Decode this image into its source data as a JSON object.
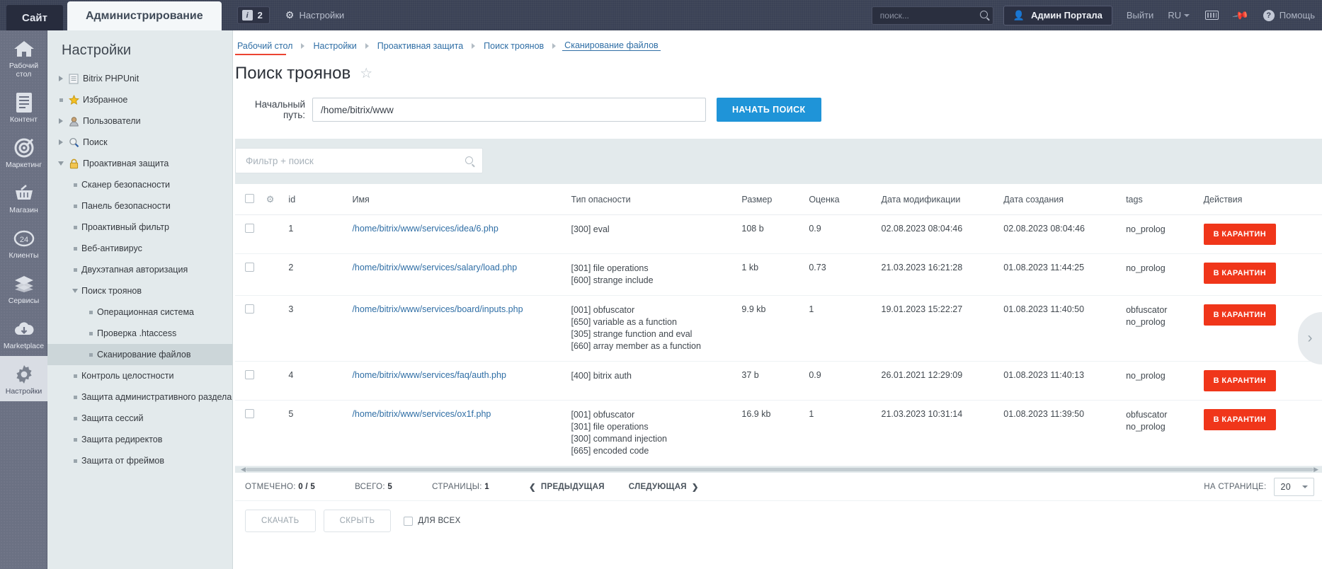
{
  "topbar": {
    "tab_site": "Сайт",
    "tab_admin": "Администрирование",
    "notifications_count": "2",
    "settings_label": "Настройки",
    "search_placeholder": "поиск...",
    "search_value": "",
    "user": "Админ Портала",
    "logout": "Выйти",
    "language": "RU",
    "help": "Помощь"
  },
  "rail": [
    {
      "label": "Рабочий стол",
      "icon": "home-icon"
    },
    {
      "label": "Контент",
      "icon": "document-icon"
    },
    {
      "label": "Маркетинг",
      "icon": "target-icon"
    },
    {
      "label": "Магазин",
      "icon": "basket-icon"
    },
    {
      "label": "Клиенты",
      "icon": "clients-24-icon"
    },
    {
      "label": "Сервисы",
      "icon": "layers-icon"
    },
    {
      "label": "Marketplace",
      "icon": "cloud-download-icon"
    },
    {
      "label": "Настройки",
      "icon": "gear-icon"
    }
  ],
  "tree": {
    "title": "Настройки",
    "items": [
      {
        "label": "Bitrix PHPUnit",
        "level": 1,
        "twisty": "right",
        "icon": "file-icon"
      },
      {
        "label": "Избранное",
        "level": 1,
        "twisty": "square",
        "icon": "star-icon"
      },
      {
        "label": "Пользователи",
        "level": 1,
        "twisty": "right",
        "icon": "user-icon"
      },
      {
        "label": "Поиск",
        "level": 1,
        "twisty": "right",
        "icon": "magnifier-icon"
      },
      {
        "label": "Проактивная защита",
        "level": 1,
        "twisty": "down",
        "icon": "lock-icon"
      },
      {
        "label": "Сканер безопасности",
        "level": 2,
        "twisty": "square",
        "icon": ""
      },
      {
        "label": "Панель безопасности",
        "level": 2,
        "twisty": "square",
        "icon": ""
      },
      {
        "label": "Проактивный фильтр",
        "level": 2,
        "twisty": "square",
        "icon": ""
      },
      {
        "label": "Веб-антивирус",
        "level": 2,
        "twisty": "square",
        "icon": ""
      },
      {
        "label": "Двухэтапная авторизация",
        "level": 2,
        "twisty": "square",
        "icon": ""
      },
      {
        "label": "Поиск троянов",
        "level": 2,
        "twisty": "down",
        "icon": ""
      },
      {
        "label": "Операционная система",
        "level": 3,
        "twisty": "square",
        "icon": ""
      },
      {
        "label": "Проверка .htaccess",
        "level": 3,
        "twisty": "square",
        "icon": ""
      },
      {
        "label": "Сканирование файлов",
        "level": 3,
        "twisty": "square",
        "icon": "",
        "selected": true
      },
      {
        "label": "Контроль целостности",
        "level": 2,
        "twisty": "square",
        "icon": ""
      },
      {
        "label": "Защита административного раздела",
        "level": 2,
        "twisty": "square",
        "icon": ""
      },
      {
        "label": "Защита сессий",
        "level": 2,
        "twisty": "square",
        "icon": ""
      },
      {
        "label": "Защита редиректов",
        "level": 2,
        "twisty": "square",
        "icon": ""
      },
      {
        "label": "Защита от фреймов",
        "level": 2,
        "twisty": "square",
        "icon": ""
      }
    ]
  },
  "breadcrumb": [
    "Рабочий стол",
    "Настройки",
    "Проактивная защита",
    "Поиск троянов",
    "Сканирование файлов"
  ],
  "page": {
    "title": "Поиск троянов",
    "path_label": "Начальный путь:",
    "path_value": "/home/bitrix/www",
    "path_placeholder": "",
    "start_button": "НАЧАТЬ ПОИСК"
  },
  "filter": {
    "placeholder": "Фильтр + поиск",
    "value": ""
  },
  "table": {
    "columns": [
      "id",
      "Имя",
      "Тип опасности",
      "Размер",
      "Оценка",
      "Дата модификации",
      "Дата создания",
      "tags",
      "Действия"
    ],
    "action_label": "В КАРАНТИН",
    "rows": [
      {
        "id": "1",
        "name": "/home/bitrix/www/services/idea/6.php",
        "types": [
          "[300] eval"
        ],
        "size": "108 b",
        "score": "0.9",
        "modified": "02.08.2023 08:04:46",
        "created": "02.08.2023 08:04:46",
        "tags": [
          "no_prolog"
        ]
      },
      {
        "id": "2",
        "name": "/home/bitrix/www/services/salary/load.php",
        "types": [
          "[301] file operations",
          "[600] strange include"
        ],
        "size": "1 kb",
        "score": "0.73",
        "modified": "21.03.2023 16:21:28",
        "created": "01.08.2023 11:44:25",
        "tags": [
          "no_prolog"
        ]
      },
      {
        "id": "3",
        "name": "/home/bitrix/www/services/board/inputs.php",
        "types": [
          "[001] obfuscator",
          "[650] variable as a function",
          "[305] strange function and eval",
          "[660] array member as a function"
        ],
        "size": "9.9 kb",
        "score": "1",
        "modified": "19.01.2023 15:22:27",
        "created": "01.08.2023 11:40:50",
        "tags": [
          "obfuscator",
          "no_prolog"
        ]
      },
      {
        "id": "4",
        "name": "/home/bitrix/www/services/faq/auth.php",
        "types": [
          "[400] bitrix auth"
        ],
        "size": "37 b",
        "score": "0.9",
        "modified": "26.01.2021 12:29:09",
        "created": "01.08.2023 11:40:13",
        "tags": [
          "no_prolog"
        ]
      },
      {
        "id": "5",
        "name": "/home/bitrix/www/services/ox1f.php",
        "types": [
          "[001] obfuscator",
          "[301] file operations",
          "[300] command injection",
          "[665] encoded code"
        ],
        "size": "16.9 kb",
        "score": "1",
        "modified": "21.03.2023 10:31:14",
        "created": "01.08.2023 11:39:50",
        "tags": [
          "obfuscator",
          "no_prolog"
        ]
      }
    ]
  },
  "pager": {
    "checked_label": "ОТМЕЧЕНО:",
    "checked_value": "0 / 5",
    "total_label": "ВСЕГО:",
    "total_value": "5",
    "pages_label": "СТРАНИЦЫ:",
    "pages_value": "1",
    "prev": "ПРЕДЫДУЩАЯ",
    "next": "СЛЕДУЮЩАЯ",
    "perpage_label": "НА СТРАНИЦЕ:",
    "perpage_value": "20"
  },
  "footer_actions": {
    "download": "СКАЧАТЬ",
    "hide": "СКРЫТЬ",
    "for_all": "ДЛЯ ВСЕХ"
  },
  "colors": {
    "accent_blue": "#1f94d8",
    "danger_red": "#f0361a",
    "breadcrumb_red": "#eb4432",
    "link_blue": "#2f6ea5"
  }
}
